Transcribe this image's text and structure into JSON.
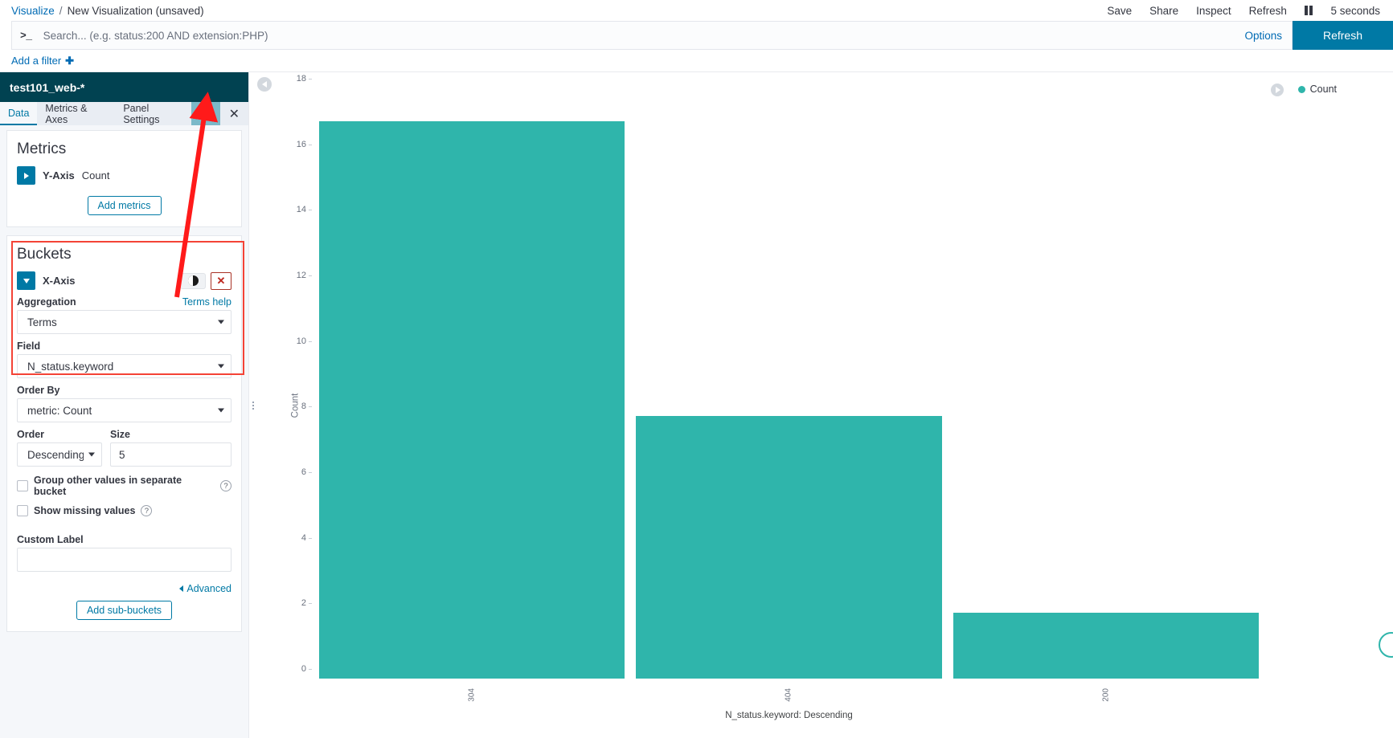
{
  "breadcrumb": {
    "root": "Visualize",
    "separator": "/",
    "current": "New Visualization (unsaved)"
  },
  "topbar": {
    "save": "Save",
    "share": "Share",
    "inspect": "Inspect",
    "refresh": "Refresh",
    "pause_icon": "pause-icon",
    "interval": "5 seconds"
  },
  "query": {
    "prompt_icon": "console-prompt-icon",
    "placeholder": "Search... (e.g. status:200 AND extension:PHP)",
    "value": "",
    "options": "Options",
    "refresh_button": "Refresh"
  },
  "filters": {
    "add_filter": "Add a filter",
    "plus_icon": "plus-icon"
  },
  "sidebar": {
    "index_title": "test101_web-*",
    "tabs": [
      {
        "label": "Data",
        "active": true
      },
      {
        "label": "Metrics & Axes",
        "active": false
      },
      {
        "label": "Panel Settings",
        "active": false
      }
    ],
    "apply_icon": "play-apply-icon",
    "close_icon": "close-icon",
    "metrics": {
      "title": "Metrics",
      "expand_icon": "chevron-right-icon",
      "axis_label": "Y-Axis",
      "axis_value": "Count",
      "add_button": "Add metrics"
    },
    "buckets": {
      "title": "Buckets",
      "collapse_icon": "chevron-down-icon",
      "axis_label": "X-Axis",
      "toggle_icon": "enable-toggle-icon",
      "delete_icon": "remove-x-icon",
      "aggregation_label": "Aggregation",
      "aggregation_help": "Terms help",
      "aggregation_value": "Terms",
      "field_label": "Field",
      "field_value": "N_status.keyword",
      "order_by_label": "Order By",
      "order_by_value": "metric: Count",
      "order_label": "Order",
      "order_value": "Descending",
      "size_label": "Size",
      "size_value": "5",
      "group_other_label": "Group other values in separate bucket",
      "group_other_checked": false,
      "show_missing_label": "Show missing values",
      "show_missing_checked": false,
      "help_icon": "question-mark-icon",
      "custom_label_label": "Custom Label",
      "custom_label_value": "",
      "custom_label_placeholder": "",
      "advanced": "Advanced",
      "add_sub_buckets": "Add sub-buckets"
    },
    "highlight_color": "#f44336",
    "accent_color": "#0079a5"
  },
  "chart_panel": {
    "collapse_left_icon": "chevron-left-circle-icon",
    "collapse_right_icon": "chevron-right-circle-icon",
    "legend_label": "Count",
    "legend_color": "#2fb5ab"
  },
  "chart_data": {
    "type": "bar",
    "title": "",
    "categories": [
      "304",
      "404",
      "200"
    ],
    "values": [
      17,
      8,
      2
    ],
    "series": [
      {
        "name": "Count",
        "values": [
          17,
          8,
          2
        ],
        "color": "#2fb5ab"
      }
    ],
    "xlabel": "N_status.keyword: Descending",
    "ylabel": "Count",
    "ylim": [
      0,
      18
    ],
    "yticks": [
      0,
      2,
      4,
      6,
      8,
      10,
      12,
      14,
      16,
      18
    ],
    "grid": false,
    "legend_position": "top-right"
  }
}
